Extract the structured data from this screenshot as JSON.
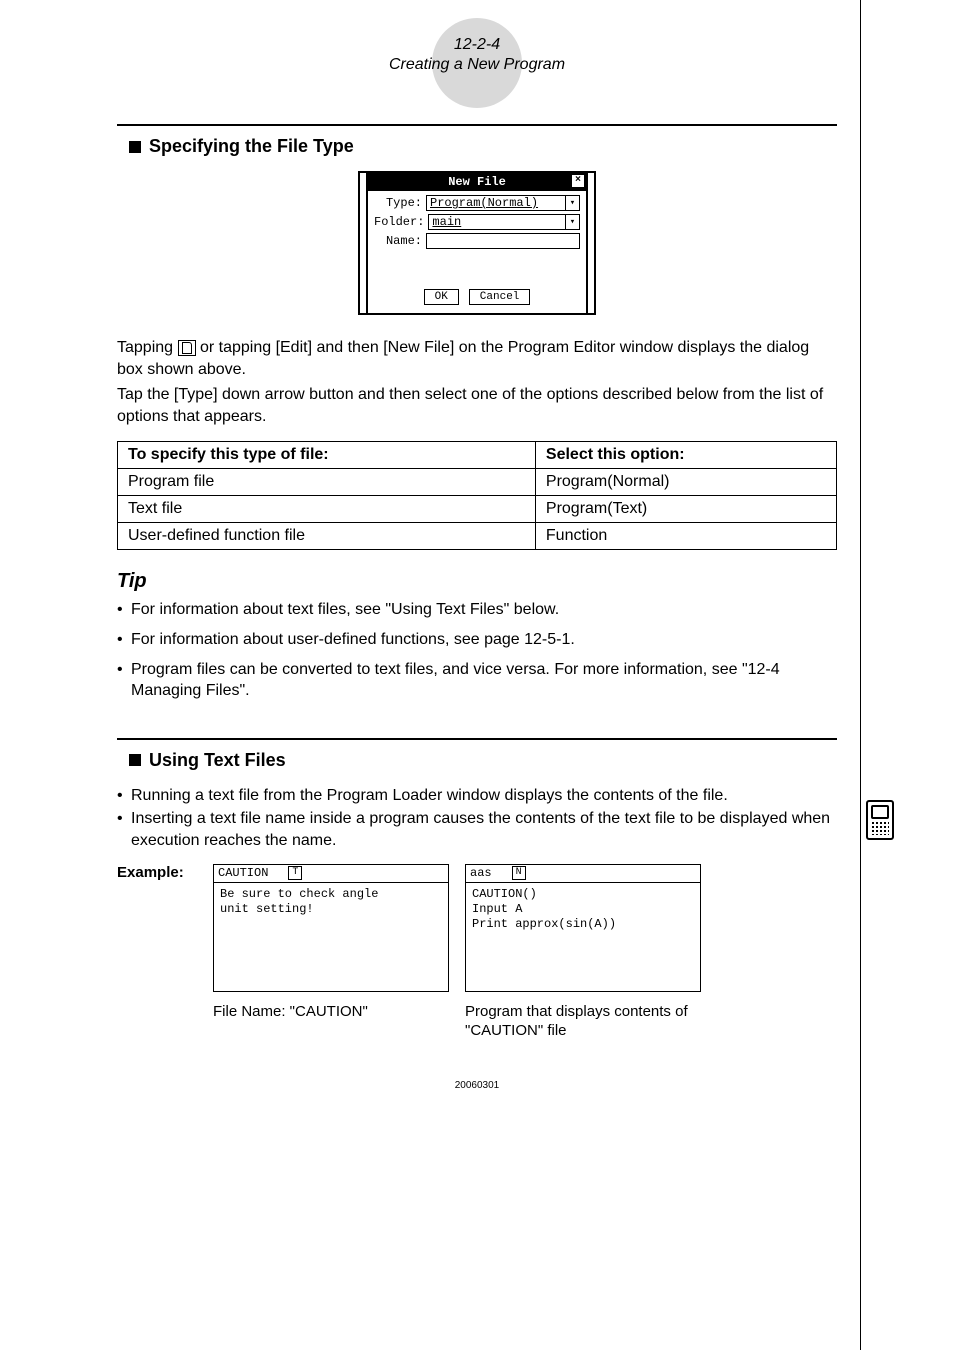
{
  "header": {
    "page_num": "12-2-4",
    "title": "Creating a New Program"
  },
  "section1": {
    "heading": "Specifying the File Type"
  },
  "dialog": {
    "title": "New File",
    "close": "×",
    "rows": {
      "type_label": "Type:",
      "type_value": "Program(Normal)",
      "folder_label": "Folder:",
      "folder_value": "main",
      "name_label": "Name:",
      "name_value": ""
    },
    "buttons": {
      "ok": "OK",
      "cancel": "Cancel"
    }
  },
  "para": {
    "p1a": "Tapping ",
    "p1b": " or tapping [Edit] and then [New File] on the Program Editor window displays the dialog box shown above.",
    "p2": "Tap the [Type] down arrow button and then select one of the options described below from the list of options that appears."
  },
  "table": {
    "head": {
      "c1": "To specify this type of file:",
      "c2": "Select this option:"
    },
    "rows": [
      {
        "c1": "Program file",
        "c2": "Program(Normal)"
      },
      {
        "c1": "Text file",
        "c2": "Program(Text)"
      },
      {
        "c1": "User-defined function file",
        "c2": "Function"
      }
    ]
  },
  "tip": {
    "heading": "Tip",
    "items": [
      "For information about text files, see \"Using Text Files\" below.",
      "For information about user-defined functions, see page 12-5-1.",
      "Program files can be converted to text files, and vice versa. For more information, see \"12-4 Managing Files\"."
    ]
  },
  "section2": {
    "heading": "Using Text Files",
    "bullets": [
      "Running a text file from the Program Loader window displays the contents of the file.",
      "Inserting a text file name inside a program causes the contents of the text file to be displayed when execution reaches the name."
    ]
  },
  "example": {
    "label": "Example:",
    "left": {
      "title": "CAUTION",
      "tag": "T",
      "body": "Be sure to check angle\nunit setting!",
      "caption": "File Name: \"CAUTION\""
    },
    "right": {
      "title": "aas",
      "tag": "N",
      "body": "CAUTION()\nInput A\nPrint approx(sin(A))",
      "caption": "Program that displays contents of \"CAUTION\" file"
    }
  },
  "footer": "20060301"
}
